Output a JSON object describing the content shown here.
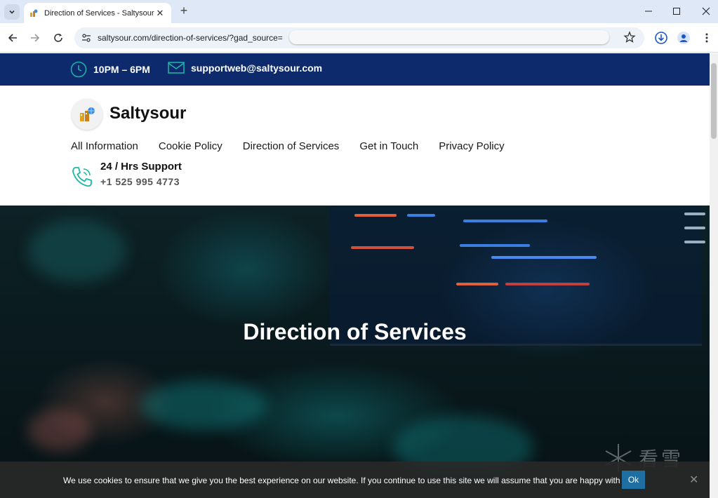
{
  "browser": {
    "tab_title": "Direction of Services - Saltysour",
    "tab_close_glyph": "✕",
    "new_tab_glyph": "+",
    "url": "saltysour.com/direction-of-services/?gad_source="
  },
  "topbar": {
    "hours": "10PM – 6PM",
    "email": "supportweb@saltysour.com",
    "background": "#0c2a6c"
  },
  "header": {
    "brand": "Saltysour",
    "menu": [
      "All Information",
      "Cookie Policy",
      "Direction of Services",
      "Get in Touch",
      "Privacy Policy"
    ],
    "support_label": "24 / Hrs Support",
    "support_phone": "+1 525 995 4773"
  },
  "hero": {
    "title": "Direction of Services"
  },
  "cookie_bar": {
    "message": "We use cookies to ensure that we give you the best experience on our website. If you continue to use this site we will assume that you are happy with it.",
    "ok_label": "Ok",
    "close_glyph": "✕"
  },
  "watermark": {
    "text": "看雪"
  },
  "colors": {
    "accent_teal": "#1bb9a6",
    "ok_button": "#1f6fa3"
  }
}
